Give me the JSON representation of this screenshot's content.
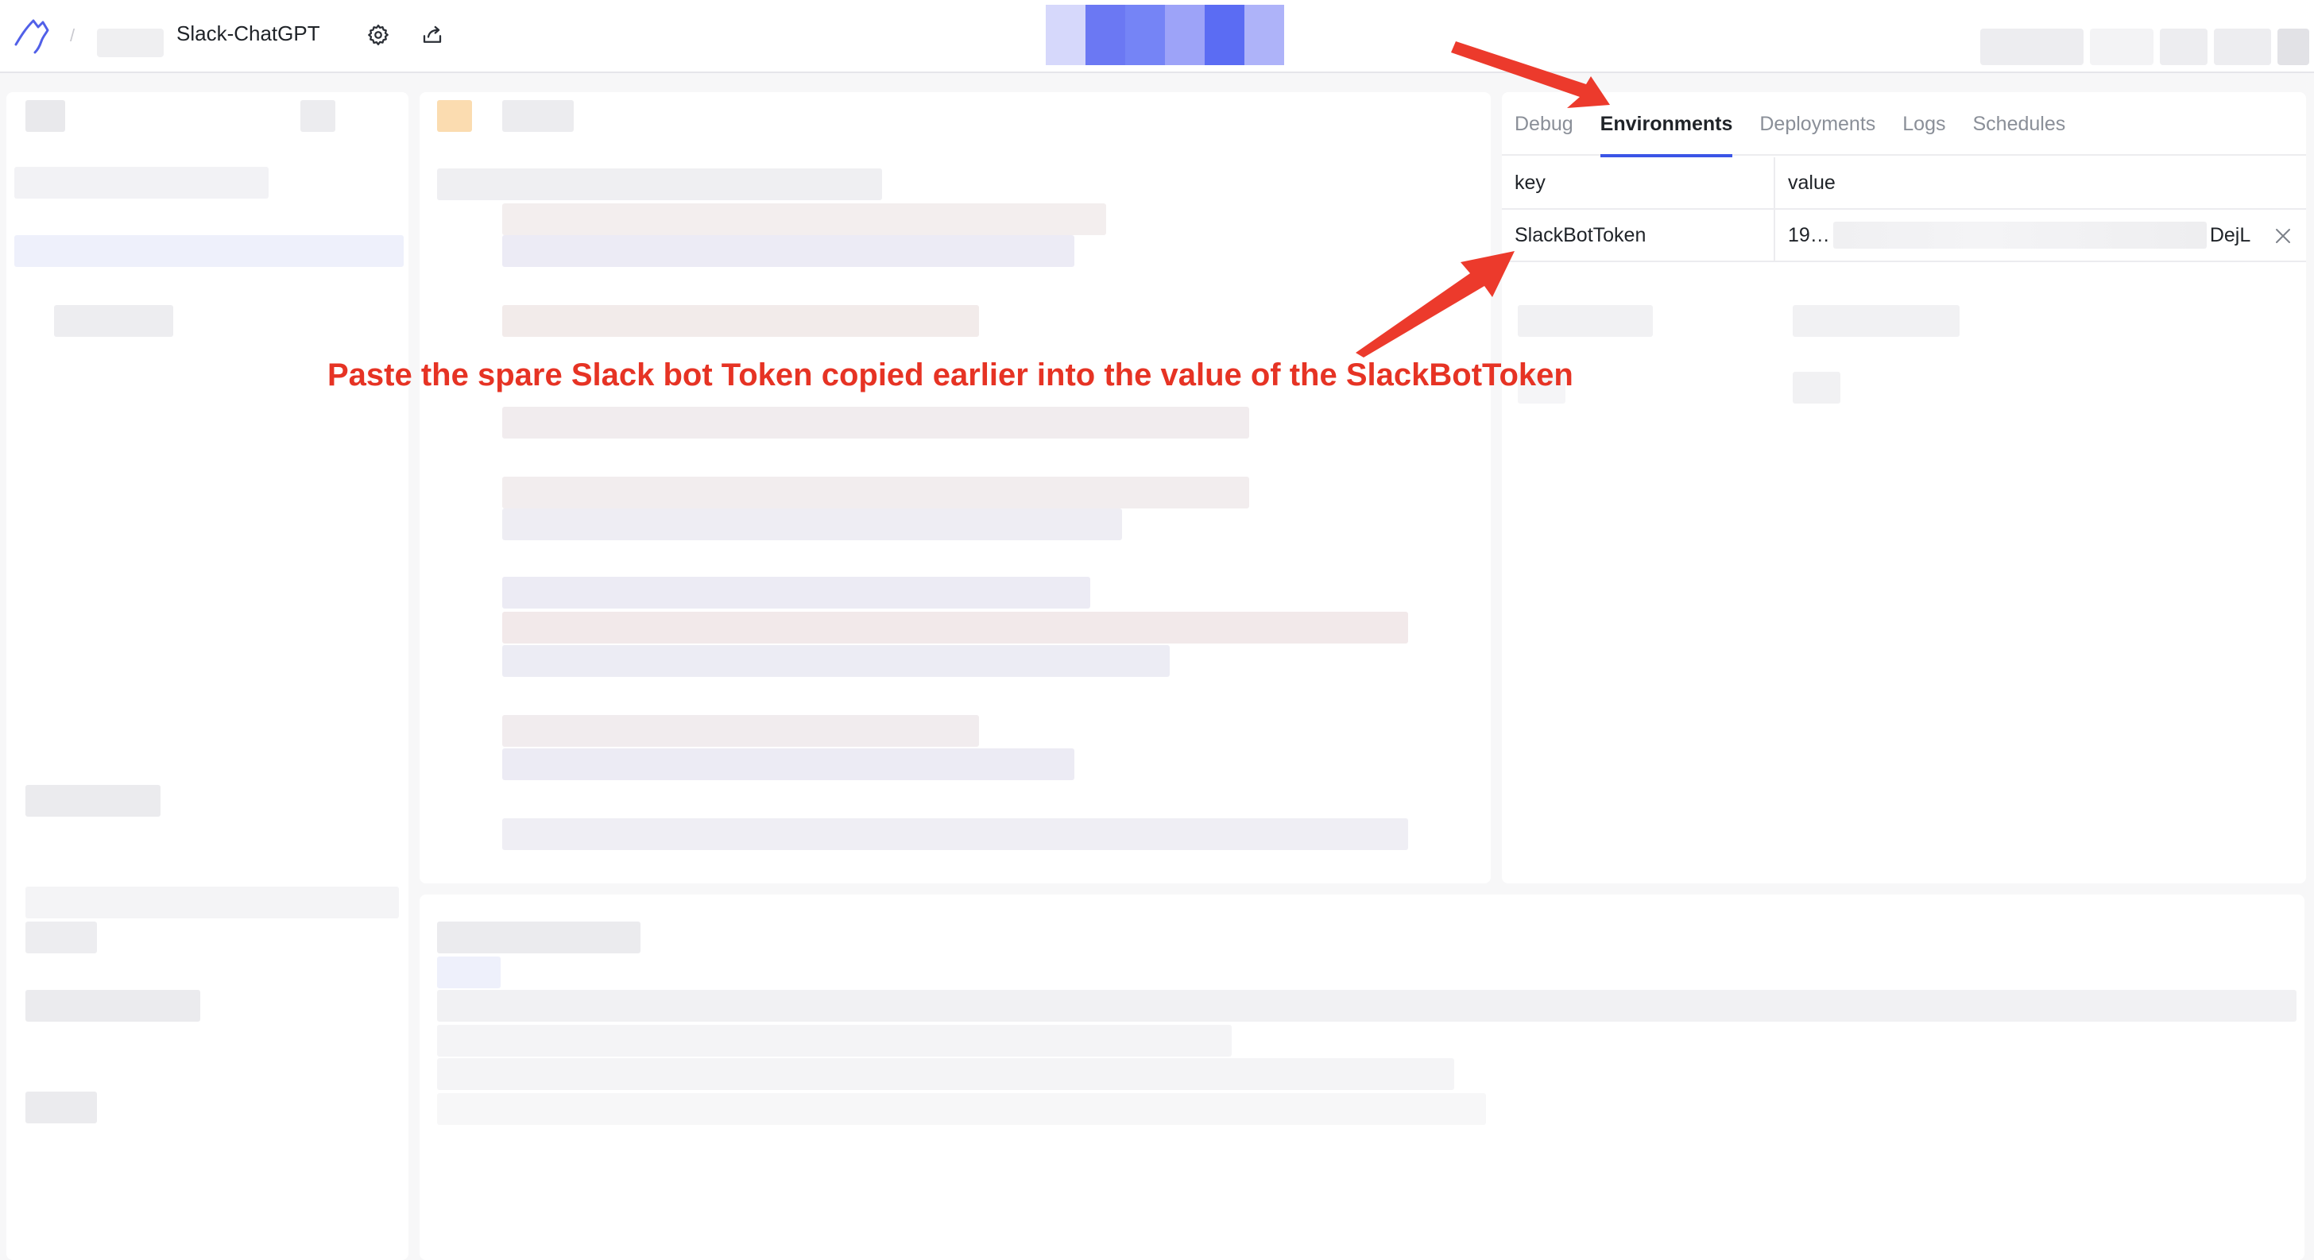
{
  "app": {
    "title": "Slack-ChatGPT"
  },
  "right_panel": {
    "tabs": [
      {
        "label": "Debug"
      },
      {
        "label": "Environments"
      },
      {
        "label": "Deployments"
      },
      {
        "label": "Logs"
      },
      {
        "label": "Schedules"
      }
    ],
    "active_tab": "Environments",
    "table": {
      "headers": {
        "key": "key",
        "value": "value"
      },
      "rows": [
        {
          "key": "SlackBotToken",
          "value_start": "19…",
          "value_end": "DejL"
        }
      ]
    }
  },
  "annotation": {
    "text": "Paste the spare Slack bot Token copied earlier into the value of the SlackBotToken",
    "color": "#e63324"
  },
  "colors": {
    "accent": "#3b55e6",
    "annotation": "#e63324"
  }
}
